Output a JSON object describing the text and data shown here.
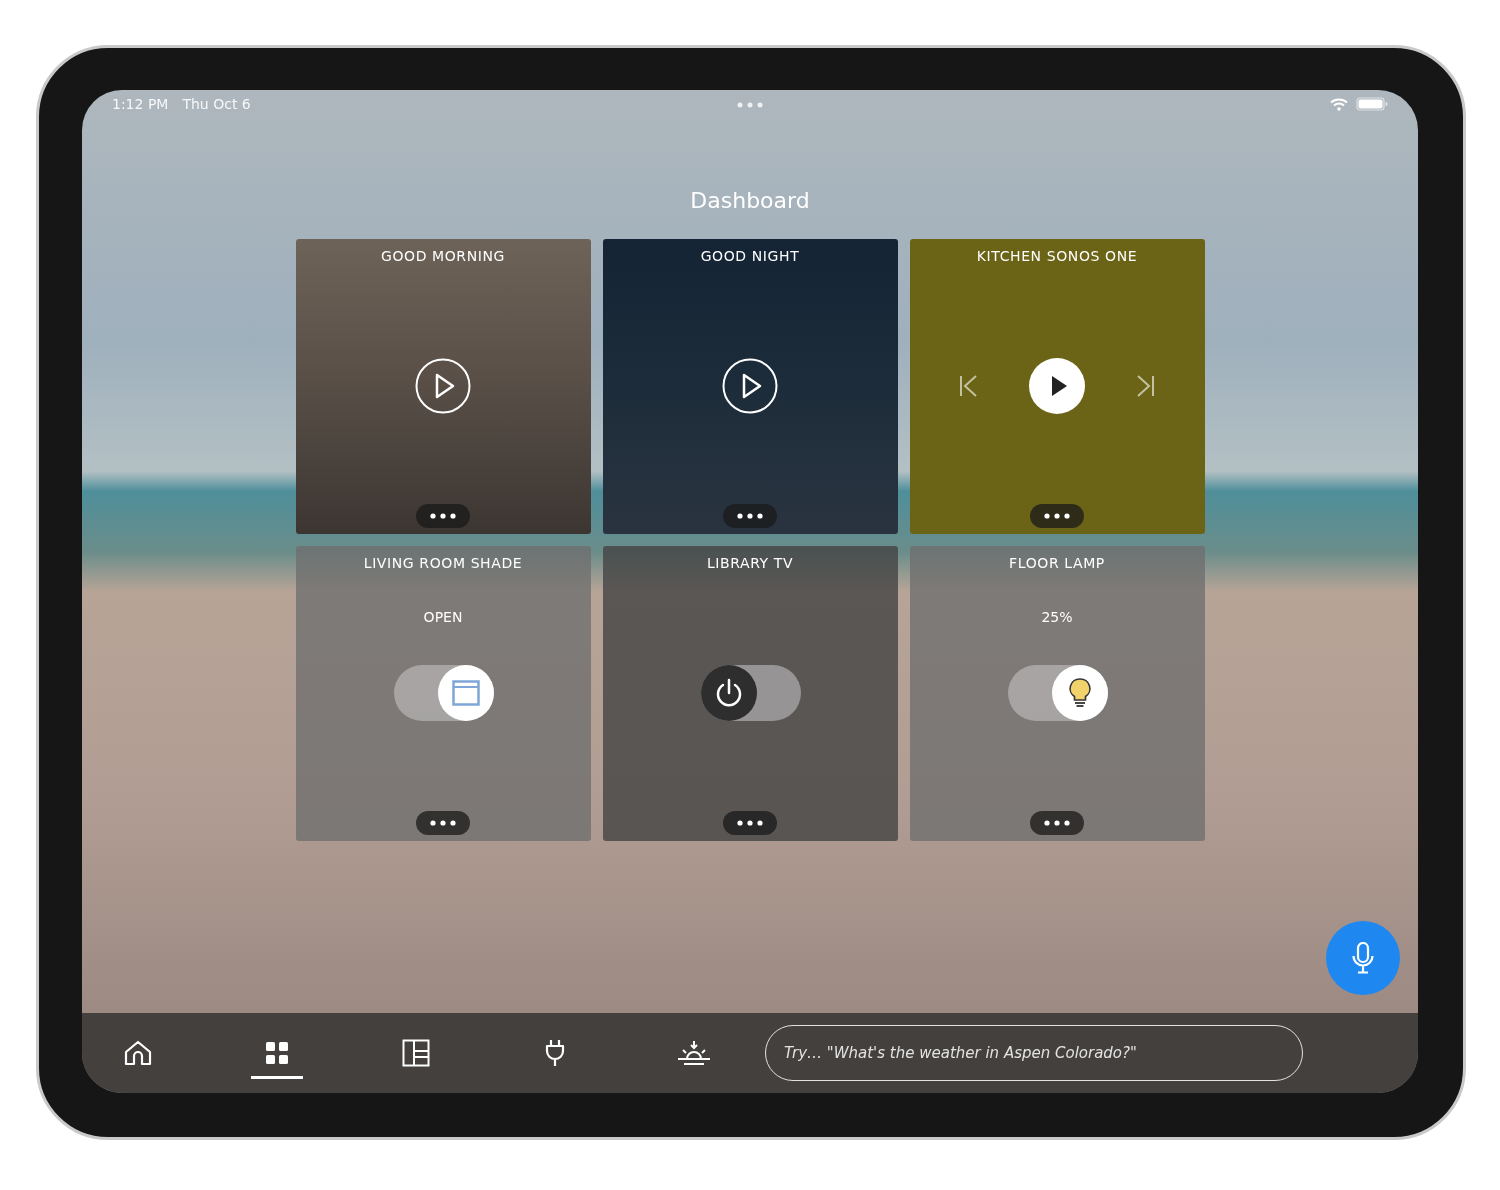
{
  "status_bar": {
    "time": "1:12 PM",
    "date": "Thu Oct 6"
  },
  "title": "Dashboard",
  "tiles": [
    {
      "kind": "scene",
      "title": "GOOD MORNING"
    },
    {
      "kind": "scene",
      "title": "GOOD NIGHT"
    },
    {
      "kind": "media",
      "title": "KITCHEN SONOS ONE"
    },
    {
      "kind": "toggle",
      "title": "LIVING ROOM SHADE",
      "status": "OPEN",
      "on": true
    },
    {
      "kind": "toggle",
      "title": "LIBRARY TV",
      "on": false
    },
    {
      "kind": "toggle",
      "title": "FLOOR LAMP",
      "status": "25%",
      "on": true
    }
  ],
  "nav": [
    {
      "selected": false
    },
    {
      "selected": true
    },
    {
      "selected": false
    },
    {
      "selected": false
    },
    {
      "selected": false
    }
  ],
  "search": {
    "placeholder": "Try… \"What's the weather in Aspen Colorado?\""
  }
}
